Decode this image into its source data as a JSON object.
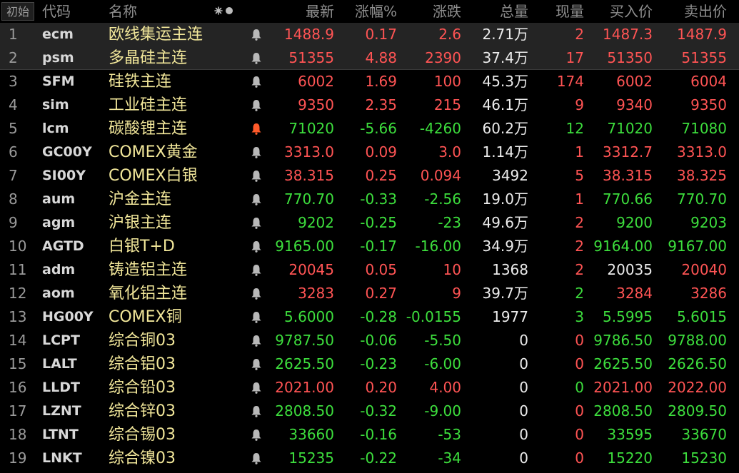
{
  "header": {
    "init_label": "初始",
    "code": "代码",
    "name": "名称",
    "latest": "最新",
    "change_pct": "涨幅%",
    "change": "涨跌",
    "volume": "总量",
    "current_volume": "现量",
    "bid": "买入价",
    "ask": "卖出价"
  },
  "colors": {
    "up": "#ff5454",
    "down": "#3dde3d",
    "neutral": "#ececec",
    "name": "#f2e79a"
  },
  "rows": [
    {
      "idx": "1",
      "code": "ecm",
      "name": "欧线集运主连",
      "alert": false,
      "latest": "1488.9",
      "pct": "0.17",
      "chg": "2.6",
      "vol": "2.71万",
      "cur": "2",
      "bid": "1487.3",
      "ask": "1487.9",
      "dir": "up",
      "bid_dir": "up",
      "ask_dir": "up",
      "vol_dir": "neutral",
      "cur_dir": "up"
    },
    {
      "idx": "2",
      "code": "psm",
      "name": "多晶硅主连",
      "alert": false,
      "latest": "51355",
      "pct": "4.88",
      "chg": "2390",
      "vol": "37.4万",
      "cur": "17",
      "bid": "51350",
      "ask": "51355",
      "dir": "up",
      "bid_dir": "up",
      "ask_dir": "up",
      "vol_dir": "neutral",
      "cur_dir": "up"
    },
    {
      "idx": "3",
      "code": "SFM",
      "name": "硅铁主连",
      "alert": false,
      "latest": "6002",
      "pct": "1.69",
      "chg": "100",
      "vol": "45.3万",
      "cur": "174",
      "bid": "6002",
      "ask": "6004",
      "dir": "up",
      "bid_dir": "up",
      "ask_dir": "up",
      "vol_dir": "neutral",
      "cur_dir": "up"
    },
    {
      "idx": "4",
      "code": "sim",
      "name": "工业硅主连",
      "alert": false,
      "latest": "9350",
      "pct": "2.35",
      "chg": "215",
      "vol": "46.1万",
      "cur": "9",
      "bid": "9340",
      "ask": "9350",
      "dir": "up",
      "bid_dir": "up",
      "ask_dir": "up",
      "vol_dir": "neutral",
      "cur_dir": "up"
    },
    {
      "idx": "5",
      "code": "lcm",
      "name": "碳酸锂主连",
      "alert": true,
      "latest": "71020",
      "pct": "-5.66",
      "chg": "-4260",
      "vol": "60.2万",
      "cur": "12",
      "bid": "71020",
      "ask": "71080",
      "dir": "down",
      "bid_dir": "down",
      "ask_dir": "down",
      "vol_dir": "neutral",
      "cur_dir": "down"
    },
    {
      "idx": "6",
      "code": "GC00Y",
      "name": "COMEX黄金",
      "alert": false,
      "latest": "3313.0",
      "pct": "0.09",
      "chg": "3.0",
      "vol": "1.14万",
      "cur": "1",
      "bid": "3312.7",
      "ask": "3313.0",
      "dir": "up",
      "bid_dir": "up",
      "ask_dir": "up",
      "vol_dir": "neutral",
      "cur_dir": "up"
    },
    {
      "idx": "7",
      "code": "SI00Y",
      "name": "COMEX白银",
      "alert": false,
      "latest": "38.315",
      "pct": "0.25",
      "chg": "0.094",
      "vol": "3492",
      "cur": "5",
      "bid": "38.315",
      "ask": "38.325",
      "dir": "up",
      "bid_dir": "up",
      "ask_dir": "up",
      "vol_dir": "neutral",
      "cur_dir": "up"
    },
    {
      "idx": "8",
      "code": "aum",
      "name": "沪金主连",
      "alert": false,
      "latest": "770.70",
      "pct": "-0.33",
      "chg": "-2.56",
      "vol": "19.0万",
      "cur": "1",
      "bid": "770.66",
      "ask": "770.70",
      "dir": "down",
      "bid_dir": "down",
      "ask_dir": "down",
      "vol_dir": "neutral",
      "cur_dir": "up"
    },
    {
      "idx": "9",
      "code": "agm",
      "name": "沪银主连",
      "alert": false,
      "latest": "9202",
      "pct": "-0.25",
      "chg": "-23",
      "vol": "49.6万",
      "cur": "2",
      "bid": "9200",
      "ask": "9203",
      "dir": "down",
      "bid_dir": "down",
      "ask_dir": "down",
      "vol_dir": "neutral",
      "cur_dir": "up"
    },
    {
      "idx": "10",
      "code": "AGTD",
      "name": "白银T+D",
      "alert": false,
      "latest": "9165.00",
      "pct": "-0.17",
      "chg": "-16.00",
      "vol": "34.9万",
      "cur": "2",
      "bid": "9164.00",
      "ask": "9167.00",
      "dir": "down",
      "bid_dir": "down",
      "ask_dir": "down",
      "vol_dir": "neutral",
      "cur_dir": "up"
    },
    {
      "idx": "11",
      "code": "adm",
      "name": "铸造铝主连",
      "alert": false,
      "latest": "20045",
      "pct": "0.05",
      "chg": "10",
      "vol": "1368",
      "cur": "2",
      "bid": "20035",
      "ask": "20040",
      "dir": "up",
      "bid_dir": "neutral",
      "ask_dir": "up",
      "vol_dir": "neutral",
      "cur_dir": "up"
    },
    {
      "idx": "12",
      "code": "aom",
      "name": "氧化铝主连",
      "alert": false,
      "latest": "3283",
      "pct": "0.27",
      "chg": "9",
      "vol": "39.7万",
      "cur": "2",
      "bid": "3284",
      "ask": "3286",
      "dir": "up",
      "bid_dir": "up",
      "ask_dir": "up",
      "vol_dir": "neutral",
      "cur_dir": "down"
    },
    {
      "idx": "13",
      "code": "HG00Y",
      "name": "COMEX铜",
      "alert": false,
      "latest": "5.6000",
      "pct": "-0.28",
      "chg": "-0.0155",
      "vol": "1977",
      "cur": "3",
      "bid": "5.5995",
      "ask": "5.6015",
      "dir": "down",
      "bid_dir": "down",
      "ask_dir": "down",
      "vol_dir": "neutral",
      "cur_dir": "down"
    },
    {
      "idx": "14",
      "code": "LCPT",
      "name": "综合铜03",
      "alert": false,
      "latest": "9787.50",
      "pct": "-0.06",
      "chg": "-5.50",
      "vol": "0",
      "cur": "0",
      "bid": "9786.50",
      "ask": "9788.00",
      "dir": "down",
      "bid_dir": "down",
      "ask_dir": "down",
      "vol_dir": "neutral",
      "cur_dir": "up"
    },
    {
      "idx": "15",
      "code": "LALT",
      "name": "综合铝03",
      "alert": false,
      "latest": "2625.50",
      "pct": "-0.23",
      "chg": "-6.00",
      "vol": "0",
      "cur": "0",
      "bid": "2625.50",
      "ask": "2626.50",
      "dir": "down",
      "bid_dir": "down",
      "ask_dir": "down",
      "vol_dir": "neutral",
      "cur_dir": "up"
    },
    {
      "idx": "16",
      "code": "LLDT",
      "name": "综合铅03",
      "alert": false,
      "latest": "2021.00",
      "pct": "0.20",
      "chg": "4.00",
      "vol": "0",
      "cur": "0",
      "bid": "2021.00",
      "ask": "2022.00",
      "dir": "up",
      "bid_dir": "up",
      "ask_dir": "up",
      "vol_dir": "neutral",
      "cur_dir": "down"
    },
    {
      "idx": "17",
      "code": "LZNT",
      "name": "综合锌03",
      "alert": false,
      "latest": "2808.50",
      "pct": "-0.32",
      "chg": "-9.00",
      "vol": "0",
      "cur": "0",
      "bid": "2808.50",
      "ask": "2809.50",
      "dir": "down",
      "bid_dir": "down",
      "ask_dir": "down",
      "vol_dir": "neutral",
      "cur_dir": "up"
    },
    {
      "idx": "18",
      "code": "LTNT",
      "name": "综合锡03",
      "alert": false,
      "latest": "33660",
      "pct": "-0.16",
      "chg": "-53",
      "vol": "0",
      "cur": "0",
      "bid": "33595",
      "ask": "33670",
      "dir": "down",
      "bid_dir": "down",
      "ask_dir": "down",
      "vol_dir": "neutral",
      "cur_dir": "up"
    },
    {
      "idx": "19",
      "code": "LNKT",
      "name": "综合镍03",
      "alert": false,
      "latest": "15235",
      "pct": "-0.22",
      "chg": "-34",
      "vol": "0",
      "cur": "0",
      "bid": "15220",
      "ask": "15230",
      "dir": "down",
      "bid_dir": "down",
      "ask_dir": "down",
      "vol_dir": "neutral",
      "cur_dir": "up"
    }
  ]
}
